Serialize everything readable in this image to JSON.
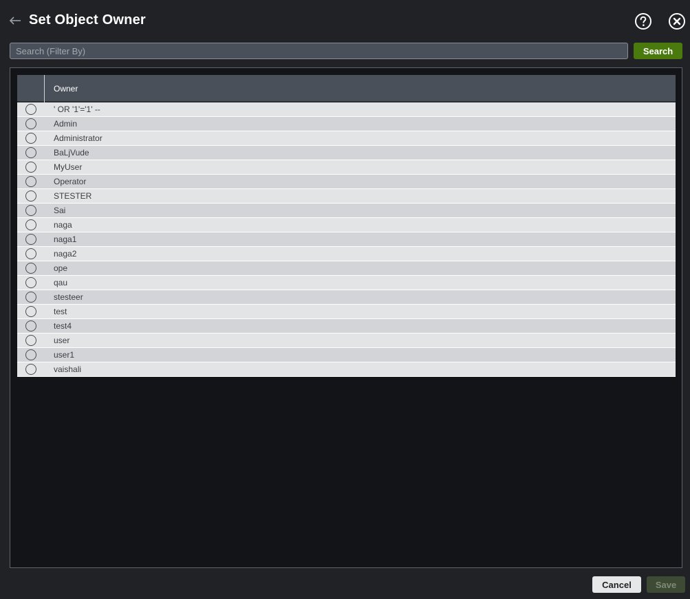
{
  "header": {
    "title": "Set Object Owner",
    "back_icon": "arrow-left-icon",
    "help_icon": "question-circle-icon",
    "close_icon": "close-circle-icon"
  },
  "search": {
    "placeholder": "Search (Filter By)",
    "value": "",
    "button_label": "Search"
  },
  "grid": {
    "columns": [
      "",
      "Owner"
    ],
    "rows": [
      "' OR '1'='1' --",
      "Admin",
      "Administrator",
      "BaLjVude",
      "MyUser",
      "Operator",
      "STESTER",
      "Sai",
      "naga",
      "naga1",
      "naga2",
      "ope",
      "qau",
      "stesteer",
      "test",
      "test4",
      "user",
      "user1",
      "vaishali"
    ]
  },
  "footer": {
    "cancel_label": "Cancel",
    "save_label": "Save"
  },
  "colors": {
    "background": "#212226",
    "accent_green": "#4a7a0e",
    "save_disabled": "#3e4a33"
  }
}
